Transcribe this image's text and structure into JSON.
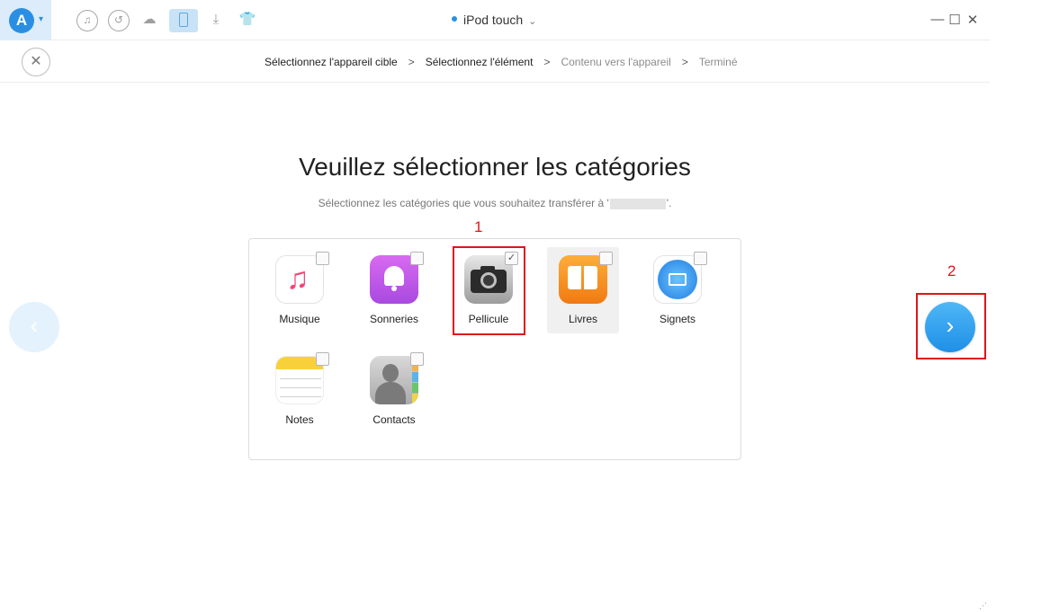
{
  "app": {
    "logo_letter": "A",
    "device_name": "iPod touch",
    "toolbar_icons": [
      "music-note-icon",
      "restore-icon",
      "cloud-icon",
      "phone-icon",
      "download-icon",
      "tshirt-icon"
    ],
    "window_controls": [
      "minimize-icon",
      "maximize-icon",
      "close-icon"
    ]
  },
  "steps": [
    {
      "label": "Sélectionnez l'appareil cible",
      "state": "done"
    },
    {
      "label": "Sélectionnez l'élément",
      "state": "current"
    },
    {
      "label": "Contenu vers l'appareil",
      "state": "pending"
    },
    {
      "label": "Terminé",
      "state": "pending"
    }
  ],
  "main": {
    "title": "Veuillez sélectionner les catégories",
    "subtitle_before": "Sélectionnez les catégories que vous souhaitez transférer à '",
    "subtitle_after": "'."
  },
  "categories": [
    {
      "label": "Musique",
      "icon": "music-icon",
      "checked": false
    },
    {
      "label": "Sonneries",
      "icon": "ringtone-icon",
      "checked": false
    },
    {
      "label": "Pellicule",
      "icon": "camera-icon",
      "checked": true
    },
    {
      "label": "Livres",
      "icon": "books-icon",
      "checked": false
    },
    {
      "label": "Signets",
      "icon": "safari-icon",
      "checked": false
    },
    {
      "label": "Notes",
      "icon": "notes-icon",
      "checked": false
    },
    {
      "label": "Contacts",
      "icon": "contacts-icon",
      "checked": false
    }
  ],
  "annotations": {
    "first": "1",
    "second": "2"
  },
  "glyphs": {
    "close": "✕",
    "check": "✓",
    "prev": "‹",
    "next": "›",
    "chevron": "⌄",
    "caret": "▾",
    "step_sep": ">"
  },
  "colors": {
    "accent": "#2a8fe3",
    "annotation": "#e0141b",
    "next_button": "#1f8fe6",
    "books": "#f17a12",
    "ringtone": "#a84ae0"
  }
}
